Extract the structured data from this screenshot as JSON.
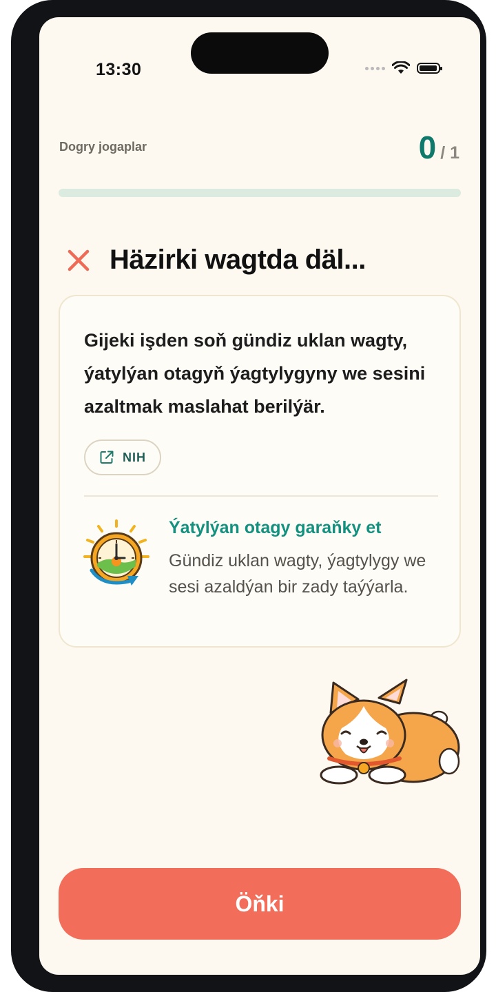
{
  "status_bar": {
    "time": "13:30"
  },
  "header": {
    "correct_label": "Dogry jogaplar",
    "score": "0",
    "total": "/ 1",
    "progress_fraction": 0
  },
  "result": {
    "title": "Häzirki wagtda däl..."
  },
  "card": {
    "text": "Gijeki işden soň gündiz uklan wagty, ýatylýan otagyň ýagtylygyny we sesini azaltmak maslahat berilýär.",
    "source_label": "NIH",
    "tip_title": "Ýatylýan otagy garaňky et",
    "tip_body": "Gündiz uklan wagty, ýagtylygy we sesi azaldýan bir zady taýýarla."
  },
  "footer": {
    "next_label": "Öňki"
  },
  "colors": {
    "accent": "#0f7a6c",
    "button": "#f36e5a",
    "error": "#ee6b57",
    "tip_title": "#14907e"
  },
  "icons": [
    "wifi-icon",
    "battery-icon",
    "close-icon",
    "external-link-icon",
    "clock-sun-icon",
    "corgi-mascot"
  ]
}
